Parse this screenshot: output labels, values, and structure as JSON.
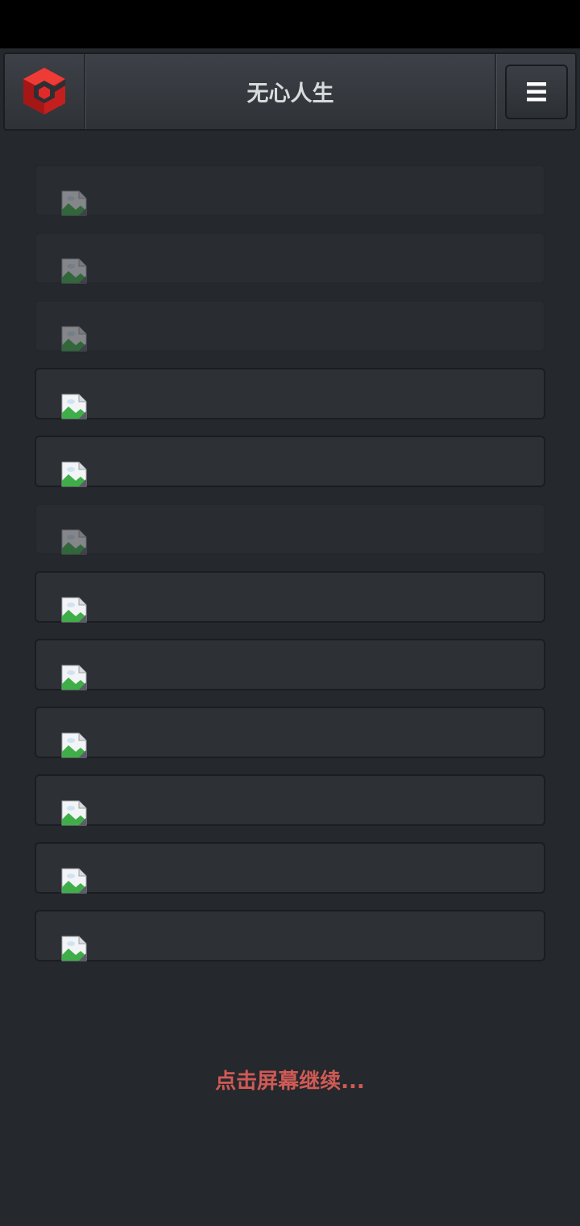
{
  "header": {
    "title": "无心人生",
    "menu_icon": "hamburger-icon",
    "logo_icon": "cube-logo-icon"
  },
  "list": {
    "items": [
      {
        "icon": "broken-image-icon",
        "state": "dim"
      },
      {
        "icon": "broken-image-icon",
        "state": "dim"
      },
      {
        "icon": "broken-image-icon",
        "state": "dim"
      },
      {
        "icon": "broken-image-icon",
        "state": "normal"
      },
      {
        "icon": "broken-image-icon",
        "state": "normal"
      },
      {
        "icon": "broken-image-icon",
        "state": "dim"
      },
      {
        "icon": "broken-image-icon",
        "state": "normal"
      },
      {
        "icon": "broken-image-icon",
        "state": "normal"
      },
      {
        "icon": "broken-image-icon",
        "state": "normal"
      },
      {
        "icon": "broken-image-icon",
        "state": "normal"
      },
      {
        "icon": "broken-image-icon",
        "state": "normal"
      },
      {
        "icon": "broken-image-icon",
        "state": "normal"
      }
    ]
  },
  "footer": {
    "continue_text": "点击屏幕继续..."
  },
  "colors": {
    "background": "#25282d",
    "accent": "#d05a55",
    "logo_red": "#e02a2a"
  }
}
